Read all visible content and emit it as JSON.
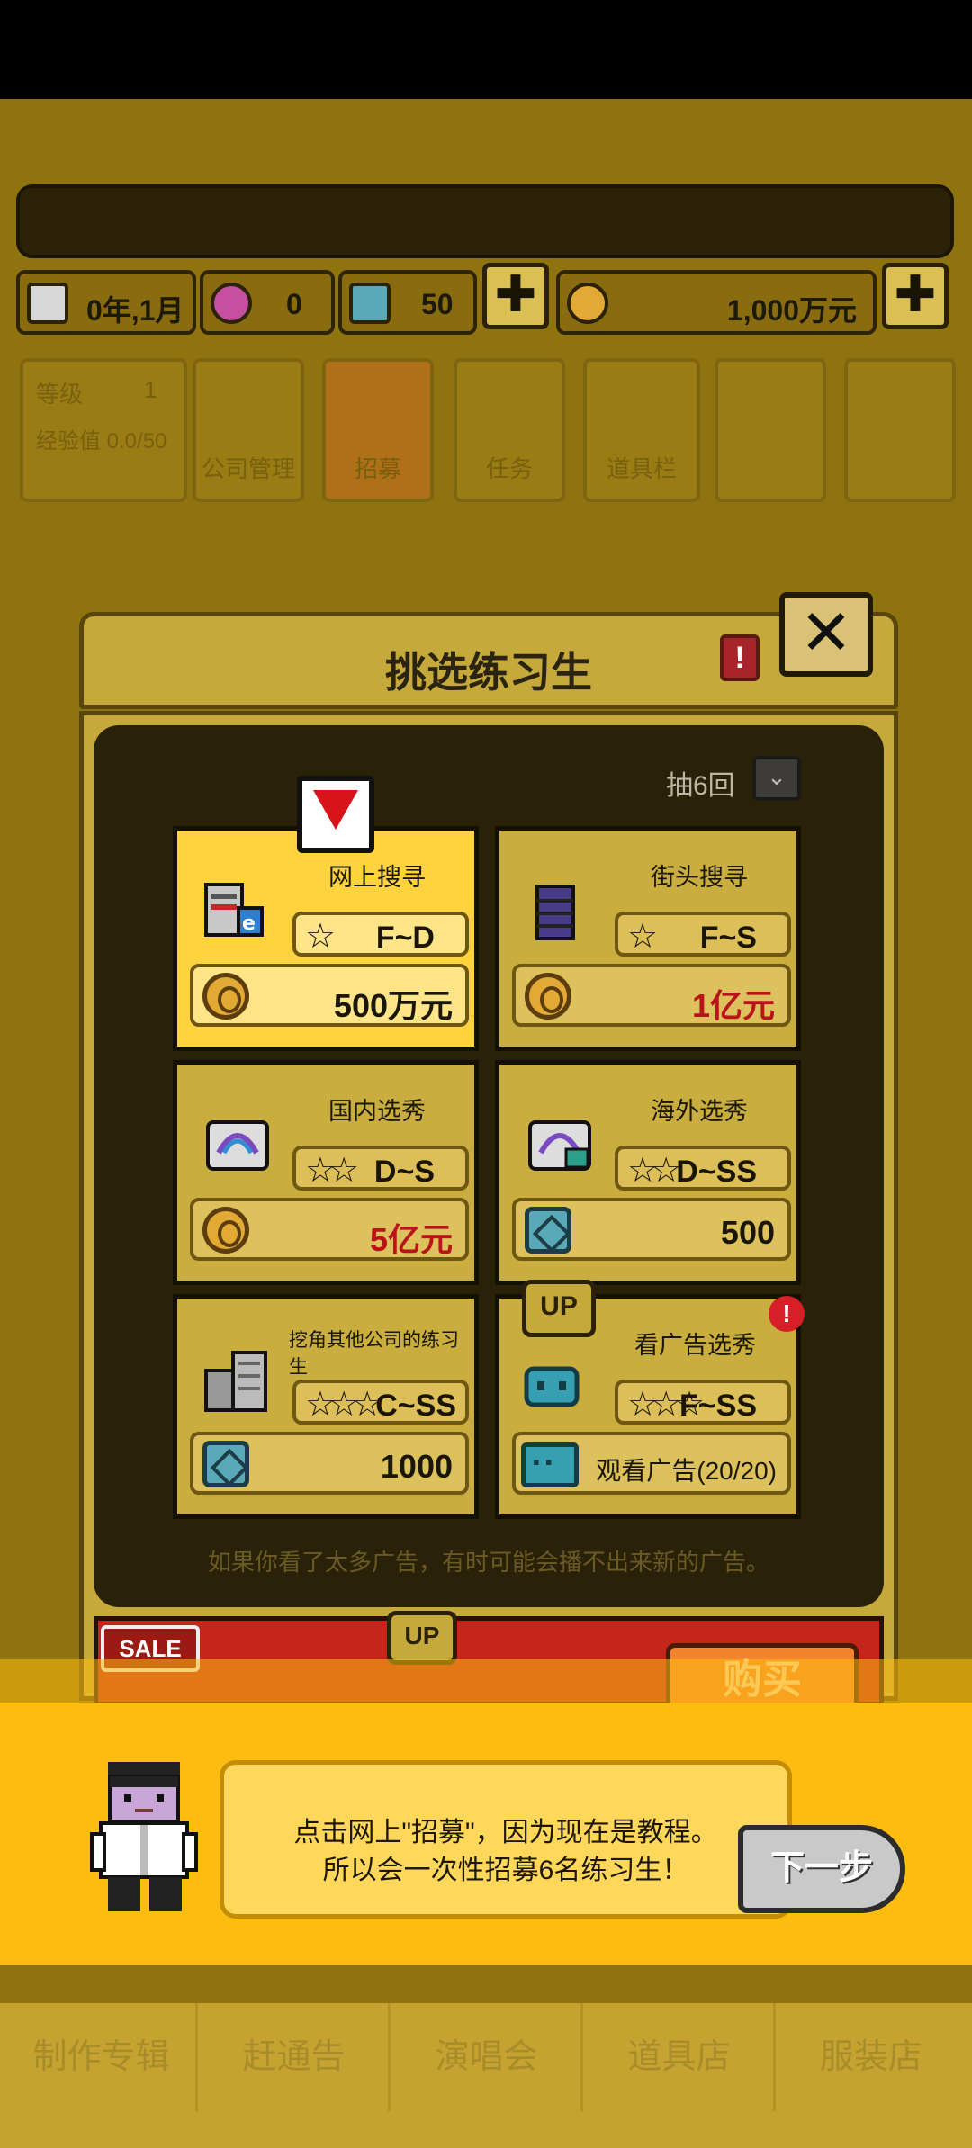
{
  "stats": {
    "date": "0年,1月",
    "hearts": "0",
    "gems": "50",
    "money": "1,000万元",
    "plus_label": "✚"
  },
  "menu": {
    "level_label": "等级",
    "level_value": "1",
    "exp_label": "经验值 0.0/50",
    "items": [
      "公司管理",
      "招募",
      "任务",
      "道具栏"
    ]
  },
  "dialog": {
    "title": "挑选练习生",
    "info_label": "!",
    "close_label": "✕",
    "draw_label": "抽6回",
    "draw_toggle": "⌄",
    "marker_label": "",
    "cards": [
      {
        "title": "网上搜寻",
        "grade": "F~D",
        "price": "500万元",
        "currency": "coin",
        "stars": "☆"
      },
      {
        "title": "街头搜寻",
        "grade": "F~S",
        "price_red": "1",
        "price_rest": "亿元",
        "currency": "coin",
        "stars": "☆"
      },
      {
        "title": "国内选秀",
        "grade": "D~S",
        "price_red": "5",
        "price_rest": "亿元",
        "currency": "coin",
        "stars": "☆☆"
      },
      {
        "title": "海外选秀",
        "grade": "D~SS",
        "price": "500",
        "currency": "gem",
        "stars": "☆☆"
      },
      {
        "title": "挖角其他公司的练习生",
        "grade": "C~SS",
        "price": "1000",
        "currency": "gem",
        "stars": "☆☆☆"
      },
      {
        "title": "看广告选秀",
        "grade": "F~SS",
        "price": "观看广告(20/20)",
        "currency": "ticket",
        "stars": "☆☆☆"
      }
    ],
    "up_label": "UP",
    "alert_label": "!",
    "note": "如果你看了太多广告，有时可能会播不出来新的广告。"
  },
  "sale": {
    "badge": "SALE",
    "up_label": "UP",
    "buy_label": "购买"
  },
  "tutorial": {
    "line1": "点击网上\"招募\"，因为现在是教程。",
    "line2": "所以会一次性招募6名练习生！",
    "next_label": "下一步"
  },
  "bottom_nav": [
    "制作专辑",
    "赶通告",
    "演唱会",
    "道具店",
    "服装店"
  ],
  "colors": {
    "accent": "#fcbc10",
    "card_selected": "#ffd33d",
    "price_red": "#b8141a"
  }
}
